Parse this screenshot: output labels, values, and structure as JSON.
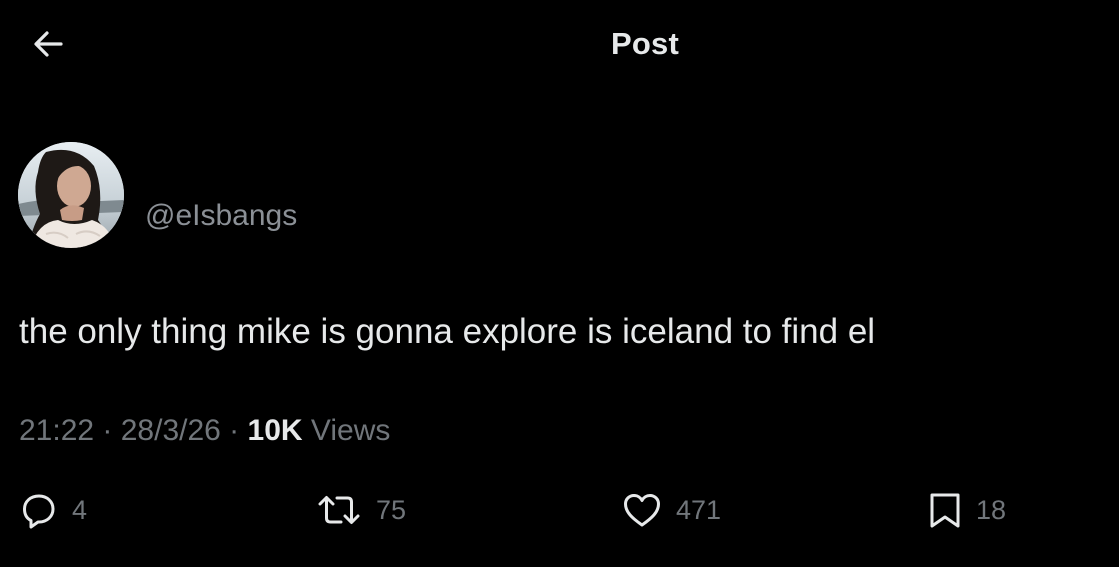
{
  "header": {
    "title": "Post",
    "back_icon": "arrow-left-icon"
  },
  "author": {
    "handle": "@eIsbangs",
    "avatar": "profile-photo"
  },
  "post": {
    "text": "the only thing mike is gonna explore is iceland to find el",
    "time": "21:22",
    "separator_1": " · ",
    "date": "28/3/26",
    "separator_2": " · ",
    "views_count": "10K",
    "views_label": " Views"
  },
  "actions": {
    "replies": {
      "icon": "reply-icon",
      "count": "4"
    },
    "reposts": {
      "icon": "repost-icon",
      "count": "75"
    },
    "likes": {
      "icon": "heart-icon",
      "count": "471"
    },
    "bookmarks": {
      "icon": "bookmark-icon",
      "count": "18"
    }
  },
  "colors": {
    "background": "#000000",
    "primary_text": "#e7e9ea",
    "secondary_text": "#71767b"
  }
}
